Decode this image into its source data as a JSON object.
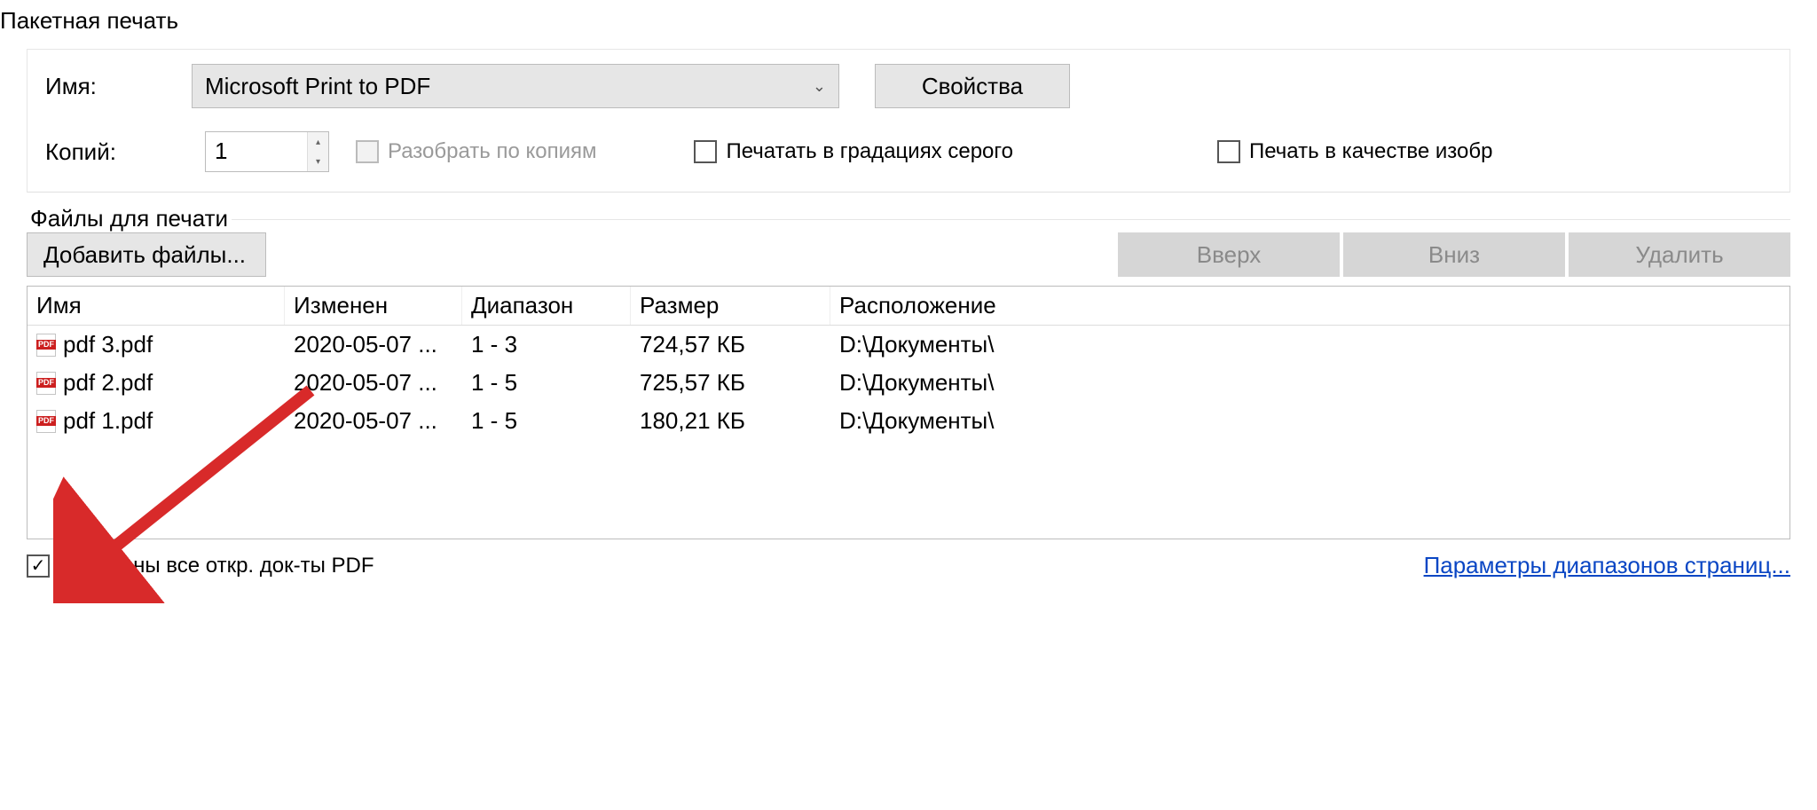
{
  "title": "Пакетная печать",
  "printer": {
    "name_label": "Имя:",
    "selected": "Microsoft Print to PDF",
    "properties_btn": "Свойства",
    "copies_label": "Копий:",
    "copies_value": "1",
    "collate_label": "Разобрать по копиям",
    "grayscale_label": "Печатать в градациях серого",
    "image_quality_label": "Печать в качестве изобр"
  },
  "files_group": {
    "legend": "Файлы для печати",
    "add_btn": "Добавить файлы...",
    "up_btn": "Вверх",
    "down_btn": "Вниз",
    "delete_btn": "Удалить",
    "columns": {
      "name": "Имя",
      "modified": "Изменен",
      "range": "Диапазон",
      "size": "Размер",
      "location": "Расположение"
    },
    "rows": [
      {
        "name": "pdf 3.pdf",
        "modified": "2020-05-07 ...",
        "range": "1 - 3",
        "size": "724,57 КБ",
        "location": "D:\\Документы\\"
      },
      {
        "name": "pdf 2.pdf",
        "modified": "2020-05-07 ...",
        "range": "1 - 5",
        "size": "725,57 КБ",
        "location": "D:\\Документы\\"
      },
      {
        "name": "pdf 1.pdf",
        "modified": "2020-05-07 ...",
        "range": "1 - 5",
        "size": "180,21 КБ",
        "location": "D:\\Документы\\"
      }
    ]
  },
  "bottom": {
    "include_open_label": "Включены все откр. док-ты PDF",
    "range_params_link": "Параметры диапазонов страниц..."
  }
}
